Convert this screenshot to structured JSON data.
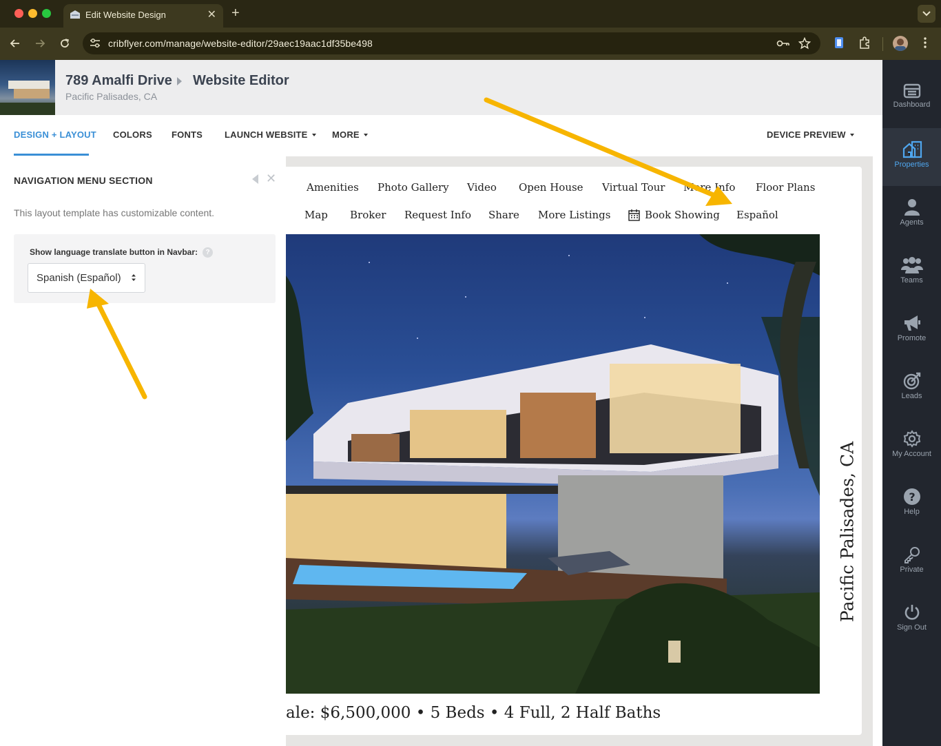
{
  "browser": {
    "tab_title": "Edit Website Design",
    "url": "cribflyer.com/manage/website-editor/29aec19aac1df35be498"
  },
  "header": {
    "address": "789 Amalfi Drive",
    "section": "Website Editor",
    "city": "Pacific Palisades, CA"
  },
  "menu": {
    "design_layout": "DESIGN + LAYOUT",
    "colors": "COLORS",
    "fonts": "FONTS",
    "launch_website": "LAUNCH WEBSITE",
    "more": "MORE",
    "device_preview": "DEVICE PREVIEW"
  },
  "panel": {
    "title": "NAVIGATION MENU SECTION",
    "description": "This layout template has customizable content.",
    "field_label": "Show language translate button in Navbar:",
    "help": "?",
    "selected_language": "Spanish (Español)"
  },
  "site_nav": {
    "row1": [
      "Amenities",
      "Photo Gallery",
      "Video",
      "Open House",
      "Virtual Tour",
      "More Info",
      "Floor Plans"
    ],
    "row2": [
      "Map",
      "Broker",
      "Request Info",
      "Share",
      "More Listings",
      "Book Showing",
      "Español"
    ]
  },
  "listing": {
    "caption": "ale: $6,500,000 • 5 Beds • 4 Full, 2 Half Baths",
    "vertical_city": "Pacific Palisades, CA"
  },
  "sidebar": {
    "items": [
      {
        "label": "Dashboard",
        "icon": "dashboard-icon"
      },
      {
        "label": "Properties",
        "icon": "properties-icon"
      },
      {
        "label": "Agents",
        "icon": "agent-icon"
      },
      {
        "label": "Teams",
        "icon": "teams-icon"
      },
      {
        "label": "Promote",
        "icon": "megaphone-icon"
      },
      {
        "label": "Leads",
        "icon": "target-icon"
      },
      {
        "label": "My Account",
        "icon": "gear-icon"
      },
      {
        "label": "Help",
        "icon": "help-icon"
      },
      {
        "label": "Private",
        "icon": "key-icon"
      },
      {
        "label": "Sign Out",
        "icon": "power-icon"
      }
    ],
    "active": "Properties"
  },
  "colors": {
    "accent": "#3a8fd6",
    "sidebar_bg": "#22262e",
    "annotation_arrow": "#f7b500"
  }
}
